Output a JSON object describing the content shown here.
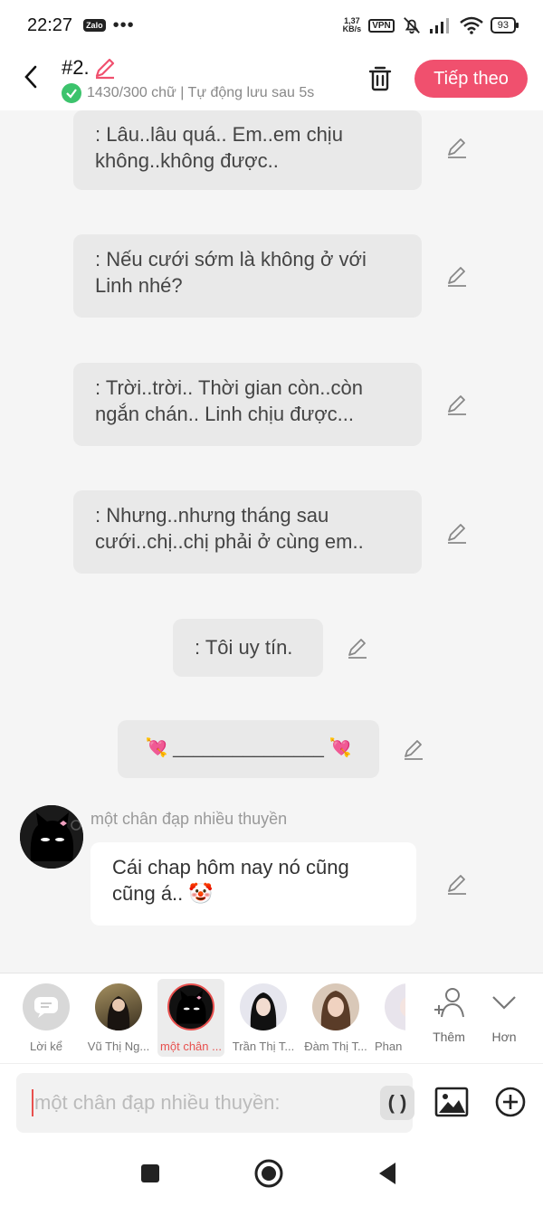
{
  "status_bar": {
    "time": "22:27",
    "zalo_badge": "Zalo",
    "dots": "•••",
    "net_speed_value": "1,37",
    "net_speed_unit": "KB/s",
    "vpn": "VPN",
    "battery": "93"
  },
  "header": {
    "chapter_title": "#2.",
    "saved_status": "1430/300 chữ | Tự động lưu sau 5s",
    "next_button": "Tiếp theo"
  },
  "messages": [
    {
      "text": ": Lâu..lâu quá.. Em..em chịu không..không được.."
    },
    {
      "text": ": Nếu cưới sớm là không ở với Linh nhé?"
    },
    {
      "text": ": Trời..trời.. Thời gian còn..còn ngắn chán.. Linh chịu được..."
    },
    {
      "text": ": Nhưng..nhưng tháng sau cưới..chị..chị phải ở cùng em.."
    },
    {
      "text": ": Tôi uy tín."
    },
    {
      "text": "💘 _______________ 💘"
    }
  ],
  "speaker_message": {
    "speaker": "một chân đạp nhiều thuyền",
    "text": "Cái chap hôm nay nó cũng cũng á.. 🤡"
  },
  "characters": [
    {
      "label": "Lời kể"
    },
    {
      "label": "Vũ Thị Ng..."
    },
    {
      "label": "một chân ..."
    },
    {
      "label": "Trần Thị T..."
    },
    {
      "label": "Đàm Thị T..."
    },
    {
      "label": "Phan"
    }
  ],
  "tools": {
    "add_label": "Thêm",
    "more_label": "Hơn"
  },
  "input": {
    "placeholder": "một chân đạp nhiều thuyền:",
    "paren_button": "( )"
  },
  "colors": {
    "accent": "#f0506e",
    "check": "#3cc36c",
    "bubble": "#e9e9e9"
  }
}
